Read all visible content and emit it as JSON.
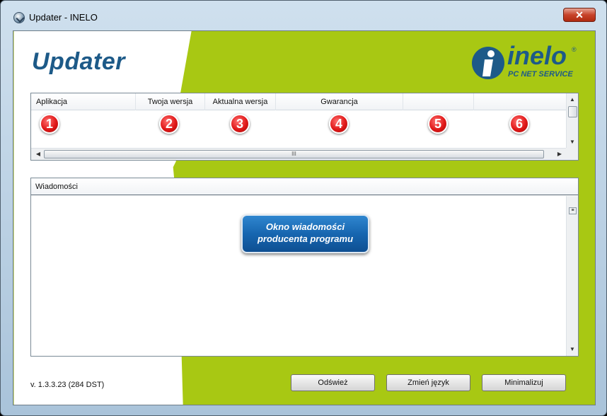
{
  "window": {
    "title": "Updater - INELO",
    "close_glyph": "✕"
  },
  "app": {
    "title": "Updater"
  },
  "logo": {
    "word": "inelo",
    "registered": "®",
    "subtitle": "PC NET SERVICE"
  },
  "colors": {
    "accent_green": "#a8c813",
    "brand_blue": "#1d5a88",
    "badge_red": "#e01818",
    "callout_blue": "#1766b0"
  },
  "grid": {
    "columns": [
      "Aplikacja",
      "Twoja wersja",
      "Aktualna wersja",
      "Gwarancja",
      "",
      ""
    ],
    "badges": [
      "1",
      "2",
      "3",
      "4",
      "5",
      "6"
    ],
    "hscroll_grip": "III"
  },
  "messages": {
    "header": "Wiadomości",
    "callout": "Okno wiadomości producenta programu"
  },
  "footer": {
    "version": "v. 1.3.3.23 (284 DST)",
    "buttons": {
      "refresh": "Odśwież",
      "language": "Zmień język",
      "minimize": "Minimalizuj"
    }
  }
}
